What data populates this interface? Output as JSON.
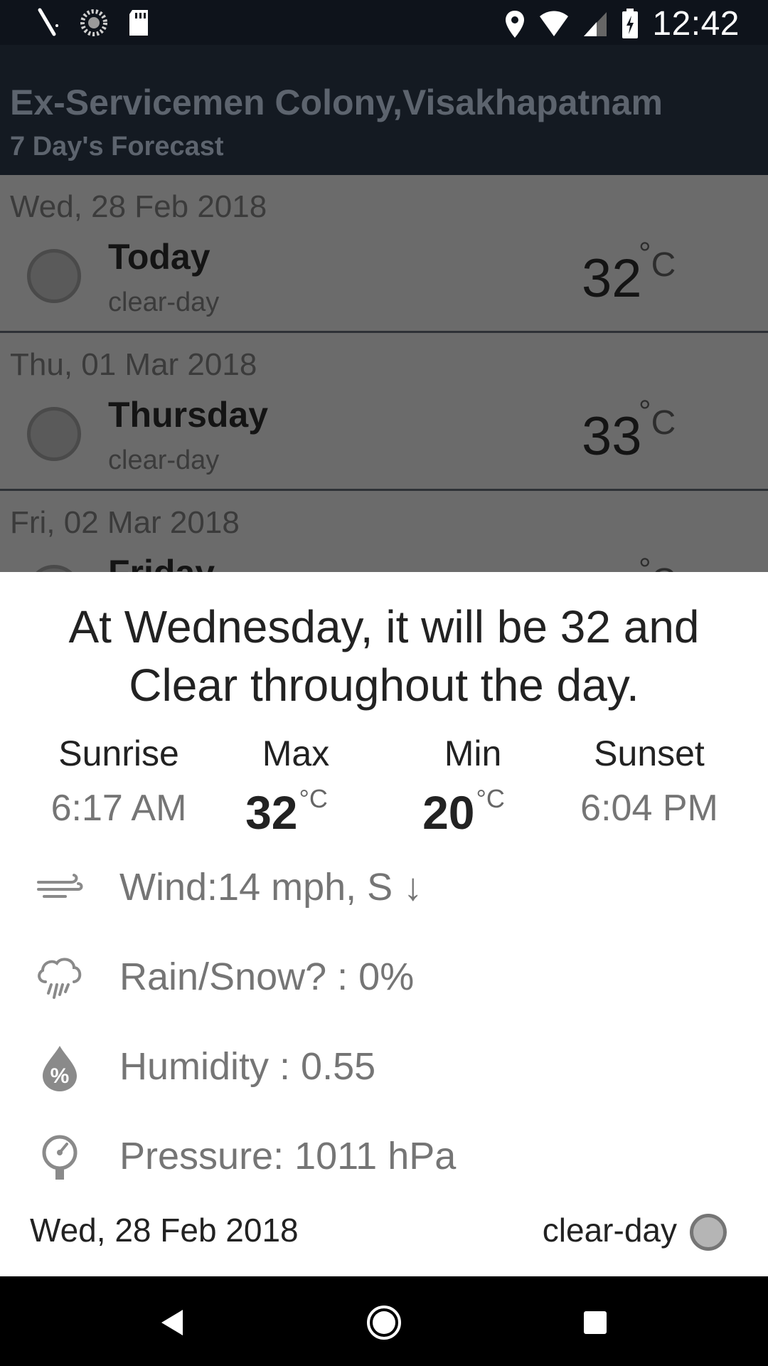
{
  "status_bar": {
    "time": "12:42",
    "left_icons": [
      "pen-icon",
      "sync-icon",
      "sd-card-icon"
    ],
    "right_icons": [
      "location-icon",
      "wifi-icon",
      "signal-icon",
      "battery-charging-icon"
    ]
  },
  "app_bar": {
    "title": "Ex-Servicemen Colony,Visakhapatnam",
    "subtitle": "7 Day's Forecast"
  },
  "forecast": [
    {
      "date": "Wed, 28 Feb 2018",
      "day": "Today",
      "condition": "clear-day",
      "temp": "32",
      "unit": "C",
      "degree": "°"
    },
    {
      "date": "Thu, 01 Mar 2018",
      "day": "Thursday",
      "condition": "clear-day",
      "temp": "33",
      "unit": "C",
      "degree": "°"
    },
    {
      "date": "Fri, 02 Mar 2018",
      "day": "Friday",
      "condition": "",
      "temp": "",
      "unit": "C",
      "degree": "°"
    }
  ],
  "sheet": {
    "headline": "At Wednesday, it will be 32 and Clear throughout the day.",
    "sunrise": {
      "label": "Sunrise",
      "value": "6:17 AM"
    },
    "max": {
      "label": "Max",
      "value": "32",
      "degree": "°",
      "unit": "C"
    },
    "min": {
      "label": "Min",
      "value": "20",
      "degree": "°",
      "unit": "C"
    },
    "sunset": {
      "label": "Sunset",
      "value": "6:04 PM"
    },
    "wind": "Wind:14 mph, S ↓",
    "rain": "Rain/Snow? : 0%",
    "humidity": "Humidity : 0.55",
    "pressure": "Pressure: 1011 hPa",
    "footer_date": "Wed, 28 Feb 2018",
    "footer_condition": "clear-day"
  },
  "colors": {
    "status_bar": "#0e131b",
    "app_bar": "#141a22",
    "scrim_list": "#6b6b6b",
    "sheet": "#ffffff",
    "muted_text": "#757575"
  }
}
